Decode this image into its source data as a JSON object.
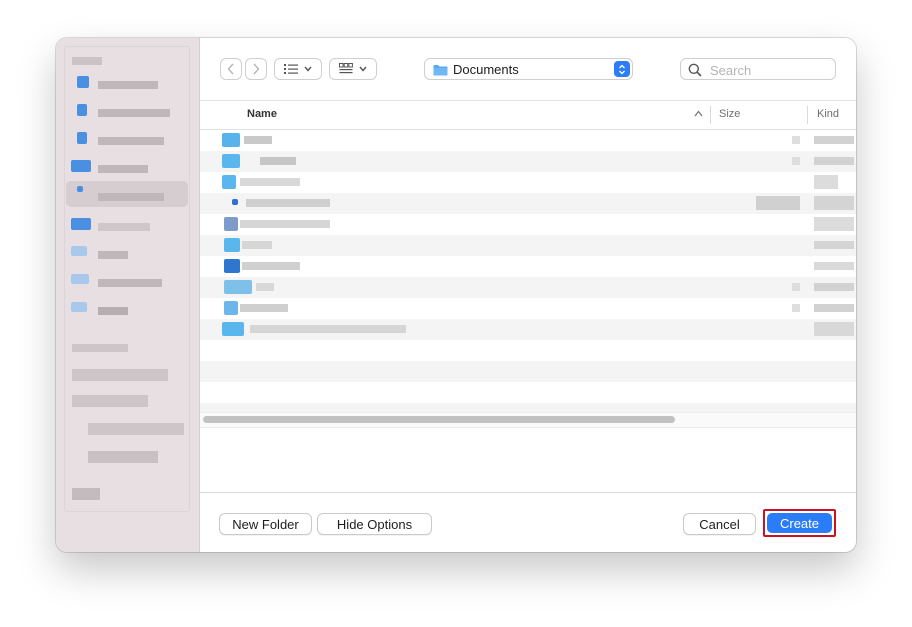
{
  "toolbar": {
    "location": "Documents",
    "search_placeholder": "Search"
  },
  "list": {
    "columns": [
      "Name",
      "Size",
      "Kind"
    ]
  },
  "footer": {
    "new_folder": "New Folder",
    "hide_options": "Hide Options",
    "cancel": "Cancel",
    "create": "Create"
  },
  "colors": {
    "accent": "#2b7cf7",
    "highlight_border": "#c81420",
    "sidebar_bg": "#e7dfe2"
  }
}
